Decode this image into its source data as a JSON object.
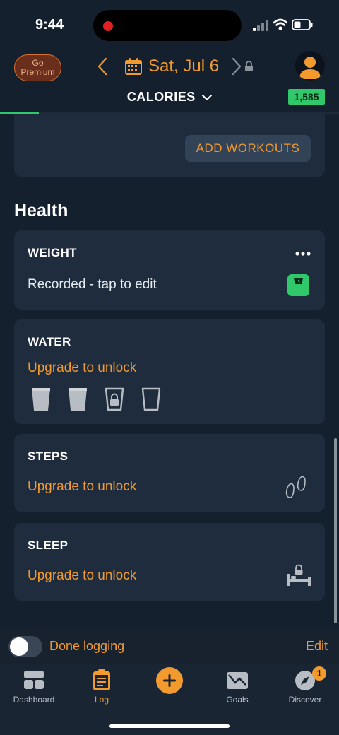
{
  "status": {
    "time": "9:44"
  },
  "header": {
    "premium_label": "Go Premium",
    "date": "Sat, Jul 6",
    "view_title": "CALORIES",
    "calorie_badge": "1,585",
    "progress": 0.115
  },
  "workouts": {
    "add_label": "ADD WORKOUTS"
  },
  "health": {
    "section_title": "Health",
    "weight": {
      "title": "WEIGHT",
      "status": "Recorded - tap to edit"
    },
    "water": {
      "title": "WATER",
      "status": "Upgrade to unlock"
    },
    "steps": {
      "title": "STEPS",
      "status": "Upgrade to unlock"
    },
    "sleep": {
      "title": "SLEEP",
      "status": "Upgrade to unlock"
    }
  },
  "footer": {
    "done_label": "Done logging",
    "edit_label": "Edit"
  },
  "tabs": [
    {
      "label": "Dashboard",
      "icon": "dashboard-icon"
    },
    {
      "label": "Log",
      "icon": "clipboard-icon"
    },
    {
      "label": "",
      "icon": "plus-icon"
    },
    {
      "label": "Goals",
      "icon": "goals-icon"
    },
    {
      "label": "Discover",
      "icon": "compass-icon",
      "badge": "1"
    }
  ],
  "colors": {
    "accent": "#f29a2e",
    "success": "#2fc86a",
    "background": "#15202e",
    "card": "#1f2c3e"
  }
}
